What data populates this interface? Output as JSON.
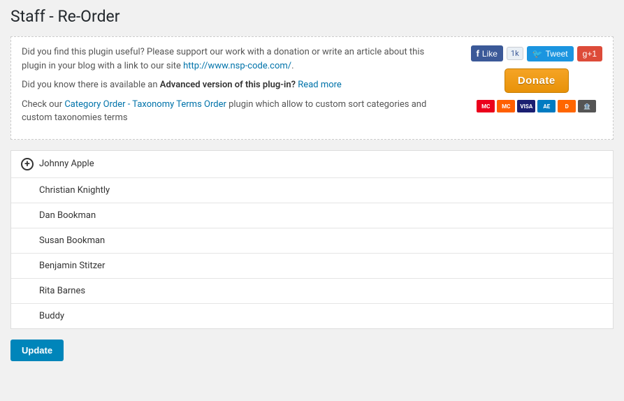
{
  "page": {
    "title": "Staff - Re-Order"
  },
  "info": {
    "line1_before": "Did you find this plugin useful? Please support our work with a donation or write an article about this plugin in your blog with a link to our site ",
    "link1_text": "http://www.nsp-code.com/",
    "line2_before": "Did you know there is available an ",
    "line2_bold": "Advanced version of this plug-in?",
    "line2_link": "Read more",
    "line3_before": "Check our ",
    "line3_link1": "Category Order - Taxonomy Terms Order",
    "line3_after": " plugin which allow to custom sort categories and custom taxonomies terms"
  },
  "social": {
    "like_label": "Like",
    "like_count": "1k",
    "tweet_label": "Tweet",
    "gplus_label": "g+1"
  },
  "donate": {
    "button_label": "Donate"
  },
  "staff": {
    "items": [
      {
        "name": "Johnny Apple"
      },
      {
        "name": "Christian Knightly"
      },
      {
        "name": "Dan Bookman"
      },
      {
        "name": "Susan Bookman"
      },
      {
        "name": "Benjamin Stitzer"
      },
      {
        "name": "Rita Barnes"
      },
      {
        "name": "Buddy"
      }
    ]
  },
  "actions": {
    "update_label": "Update"
  }
}
